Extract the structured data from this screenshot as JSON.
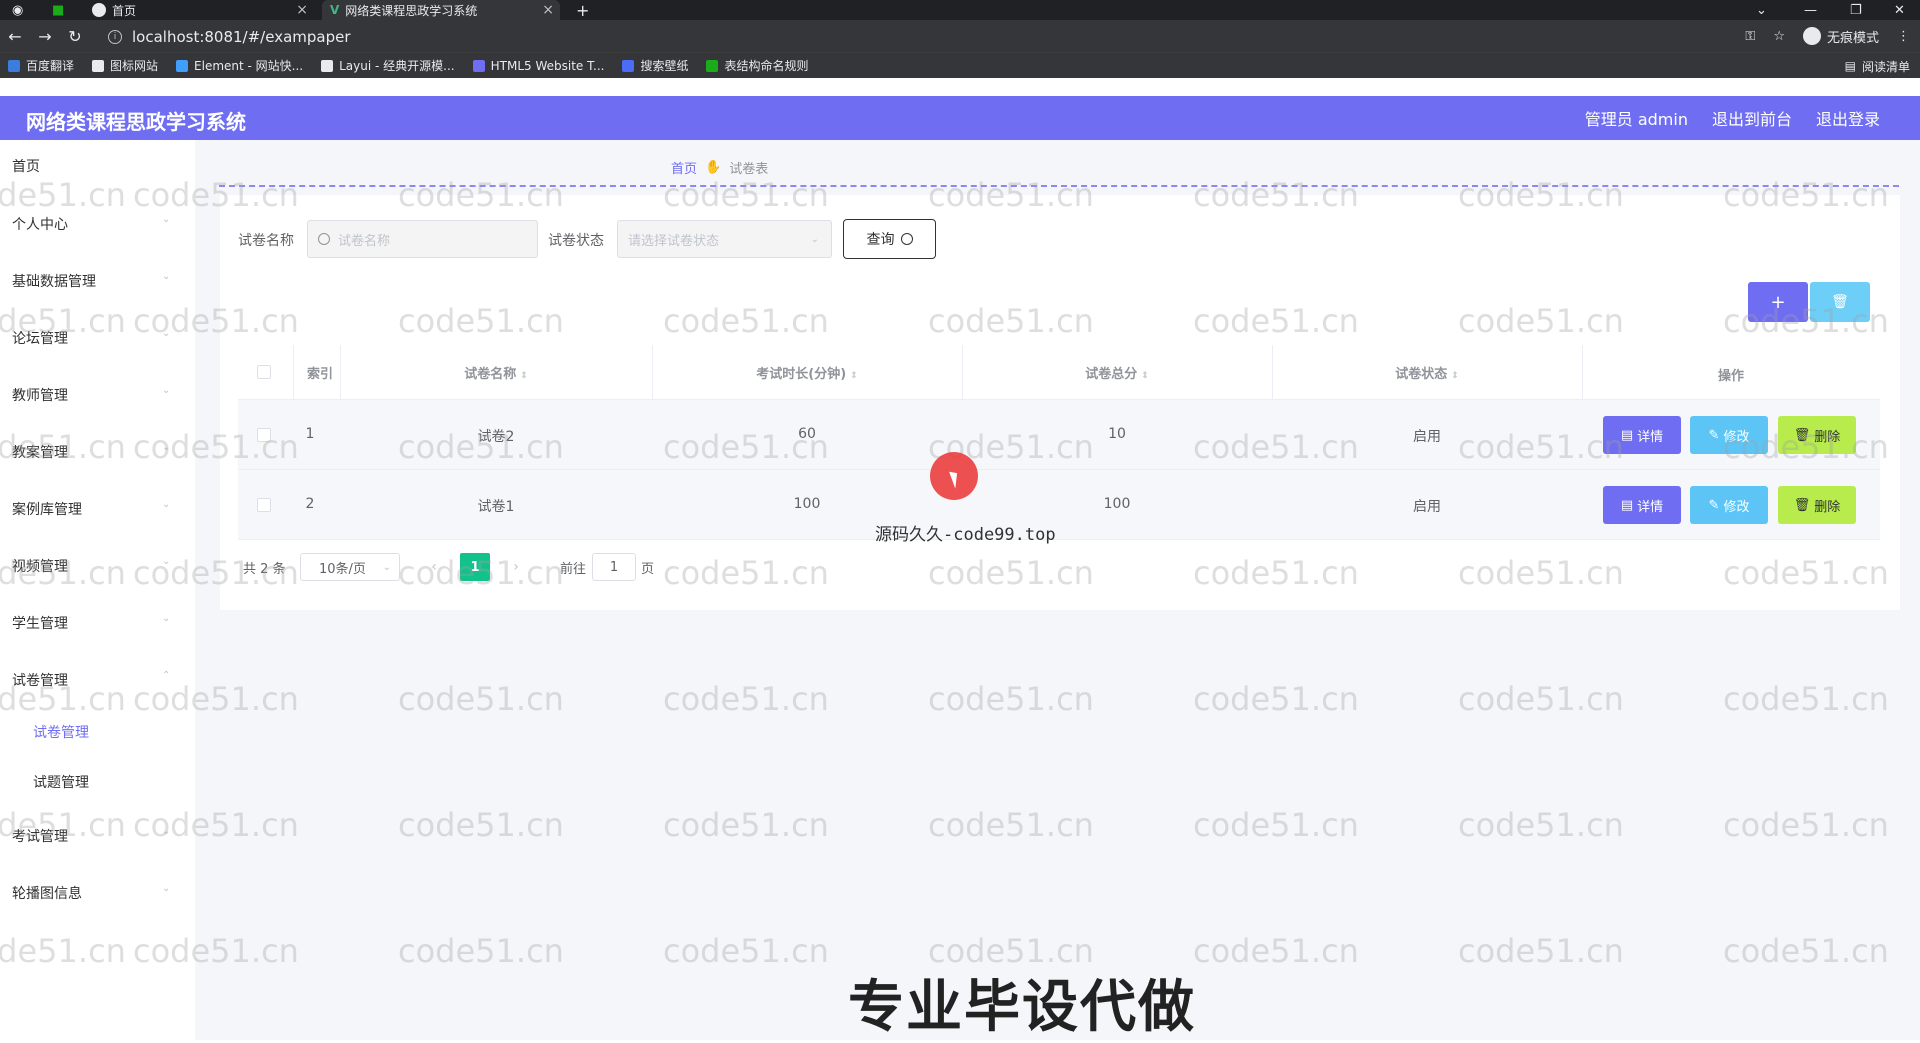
{
  "browser": {
    "tabs": [
      {
        "title": "首页"
      },
      {
        "title": "网络类课程思政学习系统"
      }
    ],
    "url": "localhost:8081/#/exampaper",
    "profile_label": "无痕模式",
    "reading_list": "阅读清单",
    "bookmarks": [
      {
        "label": "百度翻译",
        "color": "#3b7ddd"
      },
      {
        "label": "图标网站",
        "color": "#e8eaed"
      },
      {
        "label": "Element - 网站快...",
        "color": "#409eff"
      },
      {
        "label": "Layui - 经典开源模...",
        "color": "#e8eaed"
      },
      {
        "label": "HTML5 Website T...",
        "color": "#6f6ef2"
      },
      {
        "label": "搜索壁纸",
        "color": "#4a6cf7"
      },
      {
        "label": "表结构命名规则",
        "color": "#1aad19"
      }
    ]
  },
  "header": {
    "title": "网络类课程思政学习系统",
    "admin": "管理员 admin",
    "front": "退出到前台",
    "logout": "退出登录",
    "accent": "#6f6ef2"
  },
  "sidebar": {
    "items": [
      {
        "label": "首页",
        "has_arrow": false
      },
      {
        "label": "个人中心",
        "has_arrow": true
      },
      {
        "label": "基础数据管理",
        "has_arrow": true
      },
      {
        "label": "论坛管理",
        "has_arrow": true
      },
      {
        "label": "教师管理",
        "has_arrow": true
      },
      {
        "label": "教案管理",
        "has_arrow": true
      },
      {
        "label": "案例库管理",
        "has_arrow": true
      },
      {
        "label": "视频管理",
        "has_arrow": true
      },
      {
        "label": "学生管理",
        "has_arrow": true
      },
      {
        "label": "试卷管理",
        "has_arrow": true
      }
    ],
    "subitems": [
      {
        "label": "试卷管理",
        "active": true
      },
      {
        "label": "试题管理",
        "active": false
      }
    ],
    "items_after": [
      {
        "label": "考试管理",
        "has_arrow": true
      },
      {
        "label": "轮播图信息",
        "has_arrow": true
      }
    ]
  },
  "breadcrumb": {
    "home": "首页",
    "current": "试卷表"
  },
  "search": {
    "name_label": "试卷名称",
    "name_placeholder": "试卷名称",
    "status_label": "试卷状态",
    "status_placeholder": "请选择试卷状态",
    "query_label": "查询"
  },
  "actions": {
    "add_icon": "+",
    "delete_icon": "trash-icon"
  },
  "table": {
    "headers": [
      "索引",
      "试卷名称",
      "考试时长(分钟)",
      "试卷总分",
      "试卷状态",
      "操作"
    ],
    "rows": [
      {
        "index": "1",
        "name": "试卷2",
        "duration": "60",
        "score": "10",
        "status": "启用"
      },
      {
        "index": "2",
        "name": "试卷1",
        "duration": "100",
        "score": "100",
        "status": "启用"
      }
    ],
    "op_labels": {
      "detail": "详情",
      "edit": "修改",
      "delete": "删除"
    }
  },
  "pagination": {
    "total": "共 2 条",
    "page_size": "10条/页",
    "current_page": "1",
    "goto_label": "前往",
    "goto_value": "1",
    "page_unit": "页"
  },
  "overlay": {
    "caption": "源码久久-code99.top",
    "promo": "专业毕设代做",
    "watermark": "code51.cn"
  }
}
